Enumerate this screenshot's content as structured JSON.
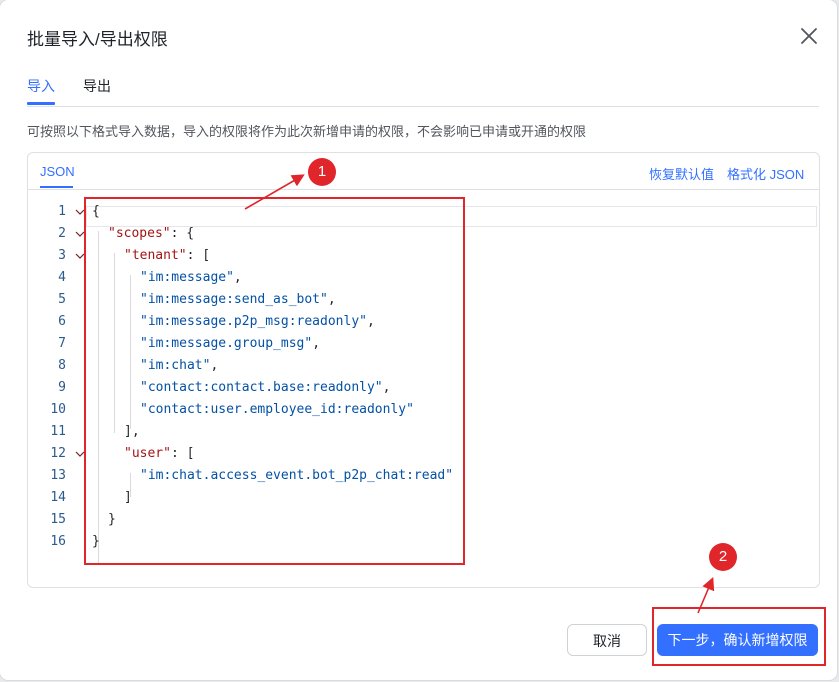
{
  "dialog": {
    "title": "批量导入/导出权限",
    "tabs": [
      {
        "label": "导入",
        "active": true
      },
      {
        "label": "导出",
        "active": false
      }
    ],
    "description": "可按照以下格式导入数据，导入的权限将作为此次新增申请的权限，不会影响已申请或开通的权限",
    "editor": {
      "tab_label": "JSON",
      "actions": {
        "restore": "恢复默认值",
        "format": "格式化 JSON"
      },
      "lines": [
        {
          "n": "1",
          "indent": 0,
          "fold": true,
          "parts": [
            {
              "t": "{",
              "c": "p"
            }
          ]
        },
        {
          "n": "2",
          "indent": 1,
          "fold": true,
          "parts": [
            {
              "t": "\"scopes\"",
              "c": "k"
            },
            {
              "t": ": {",
              "c": "p"
            }
          ]
        },
        {
          "n": "3",
          "indent": 2,
          "fold": true,
          "parts": [
            {
              "t": "\"tenant\"",
              "c": "k"
            },
            {
              "t": ": [",
              "c": "p"
            }
          ]
        },
        {
          "n": "4",
          "indent": 3,
          "fold": false,
          "parts": [
            {
              "t": "\"im:message\"",
              "c": "s"
            },
            {
              "t": ",",
              "c": "p"
            }
          ]
        },
        {
          "n": "5",
          "indent": 3,
          "fold": false,
          "parts": [
            {
              "t": "\"im:message:send_as_bot\"",
              "c": "s"
            },
            {
              "t": ",",
              "c": "p"
            }
          ]
        },
        {
          "n": "6",
          "indent": 3,
          "fold": false,
          "parts": [
            {
              "t": "\"im:message.p2p_msg:readonly\"",
              "c": "s"
            },
            {
              "t": ",",
              "c": "p"
            }
          ]
        },
        {
          "n": "7",
          "indent": 3,
          "fold": false,
          "parts": [
            {
              "t": "\"im:message.group_msg\"",
              "c": "s"
            },
            {
              "t": ",",
              "c": "p"
            }
          ]
        },
        {
          "n": "8",
          "indent": 3,
          "fold": false,
          "parts": [
            {
              "t": "\"im:chat\"",
              "c": "s"
            },
            {
              "t": ",",
              "c": "p"
            }
          ]
        },
        {
          "n": "9",
          "indent": 3,
          "fold": false,
          "parts": [
            {
              "t": "\"contact:contact.base:readonly\"",
              "c": "s"
            },
            {
              "t": ",",
              "c": "p"
            }
          ]
        },
        {
          "n": "10",
          "indent": 3,
          "fold": false,
          "parts": [
            {
              "t": "\"contact:user.employee_id:readonly\"",
              "c": "s"
            }
          ]
        },
        {
          "n": "11",
          "indent": 2,
          "fold": false,
          "parts": [
            {
              "t": "],",
              "c": "p"
            }
          ]
        },
        {
          "n": "12",
          "indent": 2,
          "fold": true,
          "parts": [
            {
              "t": "\"user\"",
              "c": "k"
            },
            {
              "t": ": [",
              "c": "p"
            }
          ]
        },
        {
          "n": "13",
          "indent": 3,
          "fold": false,
          "parts": [
            {
              "t": "\"im:chat.access_event.bot_p2p_chat:read\"",
              "c": "s"
            }
          ]
        },
        {
          "n": "14",
          "indent": 2,
          "fold": false,
          "parts": [
            {
              "t": "]",
              "c": "p"
            }
          ]
        },
        {
          "n": "15",
          "indent": 1,
          "fold": false,
          "parts": [
            {
              "t": "}",
              "c": "p"
            }
          ]
        },
        {
          "n": "16",
          "indent": 0,
          "fold": false,
          "parts": [
            {
              "t": "}",
              "c": "p"
            }
          ]
        }
      ]
    },
    "buttons": {
      "cancel": "取消",
      "confirm": "下一步，确认新增权限"
    }
  },
  "annotations": [
    {
      "label": "1",
      "color": "#e0262b"
    },
    {
      "label": "2",
      "color": "#e0262b"
    }
  ],
  "icons": {
    "close": "close-icon",
    "fold": "chevron-down-icon"
  },
  "colors": {
    "accent": "#3370ff",
    "annotation": "#e0262b",
    "json_key": "#a31515",
    "json_string": "#0451a5"
  }
}
